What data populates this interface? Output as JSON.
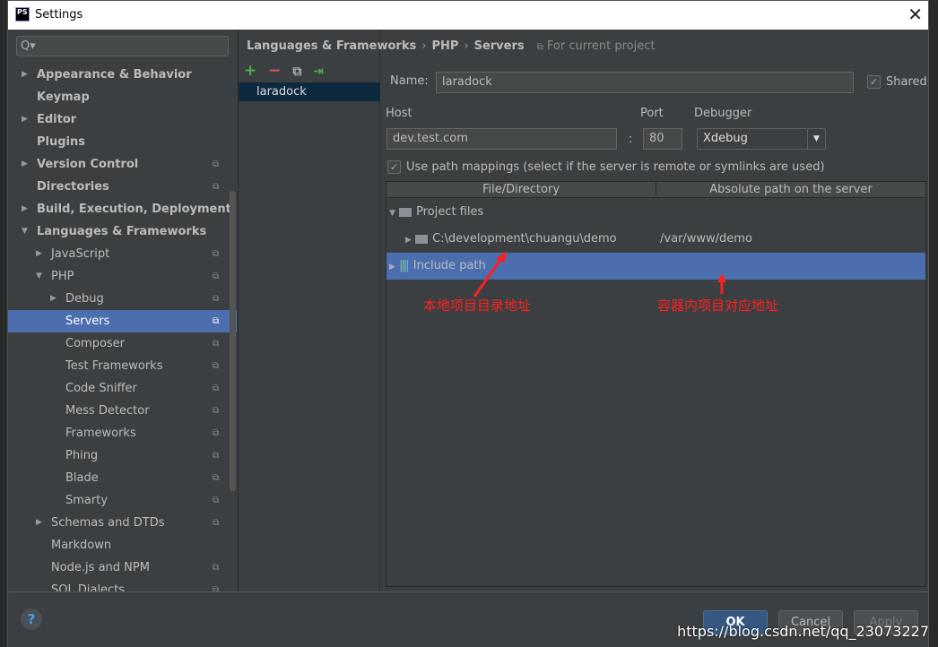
{
  "window": {
    "title": "Settings",
    "logo": "PS"
  },
  "search": {
    "placeholder": "Q▾"
  },
  "tree": [
    {
      "label": "Appearance & Behavior",
      "level": 0,
      "arrow": "right",
      "bold": true,
      "project": false
    },
    {
      "label": "Keymap",
      "level": 0,
      "arrow": "",
      "bold": true,
      "project": false
    },
    {
      "label": "Editor",
      "level": 0,
      "arrow": "right",
      "bold": true,
      "project": false
    },
    {
      "label": "Plugins",
      "level": 0,
      "arrow": "",
      "bold": true,
      "project": false
    },
    {
      "label": "Version Control",
      "level": 0,
      "arrow": "right",
      "bold": true,
      "project": true
    },
    {
      "label": "Directories",
      "level": 0,
      "arrow": "",
      "bold": true,
      "project": true
    },
    {
      "label": "Build, Execution, Deployment",
      "level": 0,
      "arrow": "right",
      "bold": true,
      "project": false
    },
    {
      "label": "Languages & Frameworks",
      "level": 0,
      "arrow": "down",
      "bold": true,
      "project": false
    },
    {
      "label": "JavaScript",
      "level": 1,
      "arrow": "right",
      "bold": false,
      "project": true
    },
    {
      "label": "PHP",
      "level": 1,
      "arrow": "down",
      "bold": false,
      "project": true
    },
    {
      "label": "Debug",
      "level": 2,
      "arrow": "right",
      "bold": false,
      "project": true
    },
    {
      "label": "Servers",
      "level": 2,
      "arrow": "",
      "bold": false,
      "project": true,
      "selected": true
    },
    {
      "label": "Composer",
      "level": 2,
      "arrow": "",
      "bold": false,
      "project": true
    },
    {
      "label": "Test Frameworks",
      "level": 2,
      "arrow": "",
      "bold": false,
      "project": true
    },
    {
      "label": "Code Sniffer",
      "level": 2,
      "arrow": "",
      "bold": false,
      "project": true
    },
    {
      "label": "Mess Detector",
      "level": 2,
      "arrow": "",
      "bold": false,
      "project": true
    },
    {
      "label": "Frameworks",
      "level": 2,
      "arrow": "",
      "bold": false,
      "project": true
    },
    {
      "label": "Phing",
      "level": 2,
      "arrow": "",
      "bold": false,
      "project": true
    },
    {
      "label": "Blade",
      "level": 2,
      "arrow": "",
      "bold": false,
      "project": true
    },
    {
      "label": "Smarty",
      "level": 2,
      "arrow": "",
      "bold": false,
      "project": true
    },
    {
      "label": "Schemas and DTDs",
      "level": 1,
      "arrow": "right",
      "bold": false,
      "project": true
    },
    {
      "label": "Markdown",
      "level": 1,
      "arrow": "",
      "bold": false,
      "project": false
    },
    {
      "label": "Node.js and NPM",
      "level": 1,
      "arrow": "",
      "bold": false,
      "project": true
    },
    {
      "label": "SQL Dialects",
      "level": 1,
      "arrow": "",
      "bold": false,
      "project": true
    }
  ],
  "breadcrumb": {
    "items": [
      "Languages & Frameworks",
      "PHP",
      "Servers"
    ],
    "scope": "For current project"
  },
  "toolbar": {
    "add": "+",
    "remove": "−",
    "copy": "⧉",
    "import": "⇥"
  },
  "servers": [
    "laradock"
  ],
  "form": {
    "name_label": "Name:",
    "name_value": "laradock",
    "shared_label": "Shared",
    "shared_checked": true,
    "host_label": "Host",
    "host_value": "dev.test.com",
    "colon": ":",
    "port_label": "Port",
    "port_value": "80",
    "debugger_label": "Debugger",
    "debugger_value": "Xdebug",
    "mappings_label": "Use path mappings (select if the server is remote or symlinks are used)",
    "mappings_checked": true
  },
  "mappings": {
    "columns": [
      "File/Directory",
      "Absolute path on the server"
    ],
    "project_files": "Project files",
    "local_path": "C:\\development\\chuangu\\demo",
    "server_path": "/var/www/demo",
    "include_path": "Include path"
  },
  "annotations": {
    "local": "本地项目目录地址",
    "container": "容器内项目对应地址"
  },
  "buttons": {
    "help": "?",
    "ok": "OK",
    "cancel": "Cancel",
    "apply": "Apply"
  },
  "watermark": "https://blog.csdn.net/qq_23073227",
  "colors": {
    "accent": "#4b6eaf",
    "annotation": "#ff2020"
  }
}
